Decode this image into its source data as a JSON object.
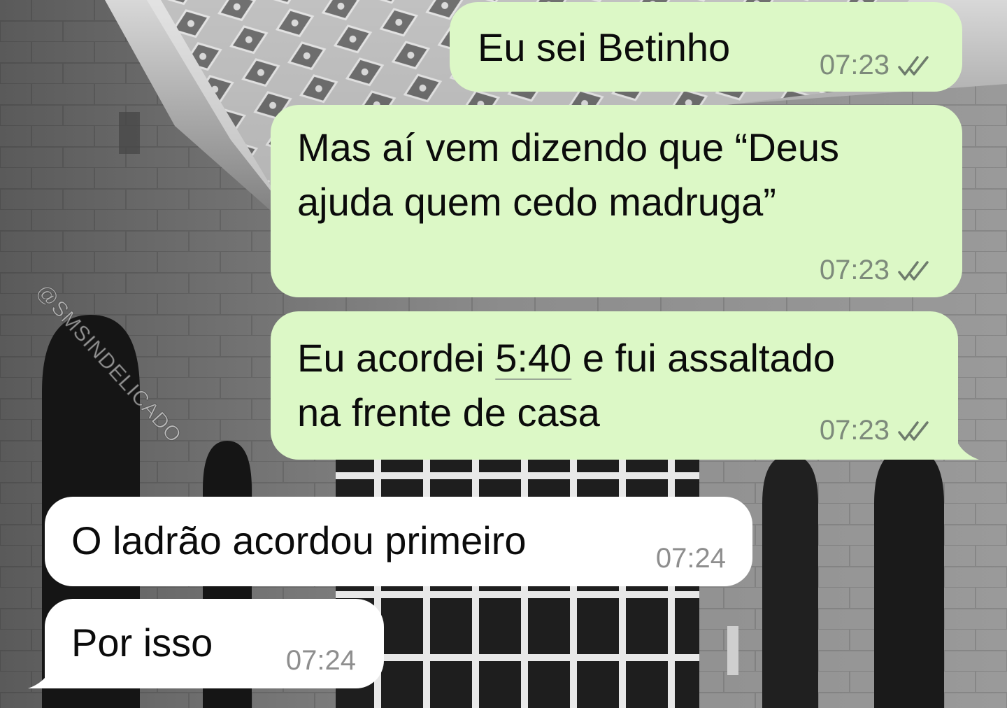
{
  "watermark": "@SMSINDELICADO",
  "colors": {
    "outgoing_bubble": "#dcf8c6",
    "incoming_bubble": "#ffffff",
    "time_text": "#7d8a7b",
    "read_ticks": "#6e7b6c"
  },
  "messages": [
    {
      "direction": "outgoing",
      "lines": [
        "Eu sei Betinho"
      ],
      "time": "07:23",
      "status_icon": "double-check-icon"
    },
    {
      "direction": "outgoing",
      "lines": [
        "Mas aí vem dizendo que “Deus",
        "ajuda quem cedo madruga”"
      ],
      "time": "07:23",
      "status_icon": "double-check-icon"
    },
    {
      "direction": "outgoing",
      "line1_before": "Eu acordei ",
      "line1_link": "5:40",
      "line1_after": " e fui assaltado",
      "line2": "na frente de casa",
      "time": "07:23",
      "status_icon": "double-check-icon"
    },
    {
      "direction": "incoming",
      "lines": [
        "O ladrão acordou primeiro"
      ],
      "time": "07:24"
    },
    {
      "direction": "incoming",
      "lines": [
        "Por isso"
      ],
      "time": "07:24"
    }
  ]
}
